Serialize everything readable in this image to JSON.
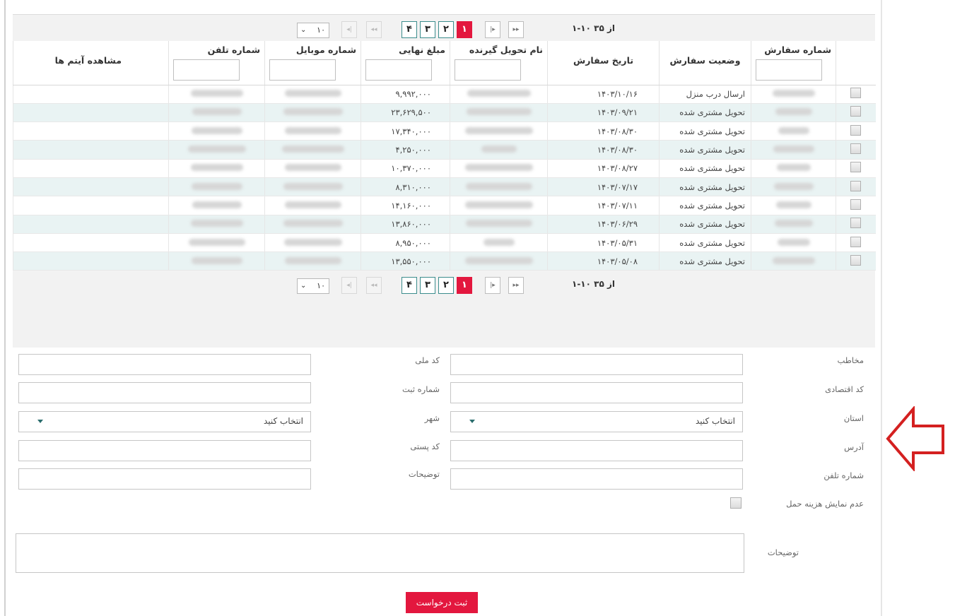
{
  "pager": {
    "summary": "از ۳۵ ۱۰-۱",
    "pages": [
      "۴",
      "۳",
      "۲",
      "۱"
    ],
    "active_page": "۱",
    "page_size": "۱۰",
    "first_label": "|◂",
    "prev_label": "◂◂",
    "next_label": "▸|",
    "last_label": "▸▸"
  },
  "table": {
    "headers": {
      "select": "",
      "order_number": "شماره سفارش",
      "order_status": "وضعیت سفارش",
      "order_date": "تاریخ سفارش",
      "recipient": "نام تحویل گیرنده",
      "final_amount": "مبلغ نهایی",
      "mobile": "شماره موبایل",
      "phone": "شماره تلفن",
      "view_items": "مشاهده آیتم ها"
    },
    "rows": [
      {
        "status": "ارسال درب منزل",
        "date": "۱۴۰۳/۱۰/۱۶",
        "amount": "۹,۹۹۲,۰۰۰"
      },
      {
        "status": "تحویل مشتری شده",
        "date": "۱۴۰۳/۰۹/۲۱",
        "amount": "۲۳,۶۲۹,۵۰۰"
      },
      {
        "status": "تحویل مشتری شده",
        "date": "۱۴۰۳/۰۸/۳۰",
        "amount": "۱۷,۳۴۰,۰۰۰"
      },
      {
        "status": "تحویل مشتری شده",
        "date": "۱۴۰۳/۰۸/۳۰",
        "amount": "۴,۲۵۰,۰۰۰"
      },
      {
        "status": "تحویل مشتری شده",
        "date": "۱۴۰۳/۰۸/۲۷",
        "amount": "۱۰,۳۷۰,۰۰۰"
      },
      {
        "status": "تحویل مشتری شده",
        "date": "۱۴۰۳/۰۷/۱۷",
        "amount": "۸,۳۱۰,۰۰۰"
      },
      {
        "status": "تحویل مشتری شده",
        "date": "۱۴۰۳/۰۷/۱۱",
        "amount": "۱۴,۱۶۰,۰۰۰"
      },
      {
        "status": "تحویل مشتری شده",
        "date": "۱۴۰۳/۰۶/۲۹",
        "amount": "۱۳,۸۶۰,۰۰۰"
      },
      {
        "status": "تحویل مشتری شده",
        "date": "۱۴۰۳/۰۵/۳۱",
        "amount": "۸,۹۵۰,۰۰۰"
      },
      {
        "status": "تحویل مشتری شده",
        "date": "۱۴۰۳/۰۵/۰۸",
        "amount": "۱۳,۵۵۰,۰۰۰"
      }
    ]
  },
  "form": {
    "contact_label": "مخاطب",
    "national_code_label": "کد ملی",
    "economic_code_label": "کد اقتصادی",
    "registration_label": "شماره ثبت",
    "province_label": "استان",
    "province_value": "انتخاب کنید",
    "city_label": "شهر",
    "city_value": "انتخاب کنید",
    "address_label": "آدرس",
    "postal_code_label": "کد پستی",
    "phone_label": "شماره تلفن",
    "notes_small_label": "توضیحات",
    "hide_shipping_label": "عدم نمایش هزینه حمل",
    "notes_label": "توضیحات",
    "submit_label": "ثبت درخواست"
  },
  "colors": {
    "accent": "#e3173e",
    "row_alt": "#e9f3f3",
    "annotation_arrow": "#d42020"
  }
}
